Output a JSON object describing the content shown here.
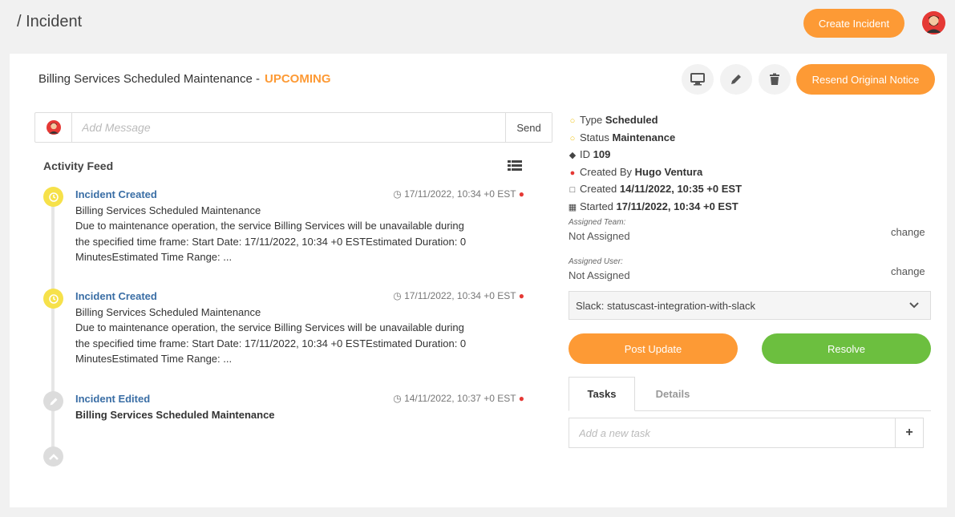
{
  "header": {
    "title": "/ Incident",
    "create_label": "Create Incident"
  },
  "incident": {
    "name": "Billing Services Scheduled Maintenance -",
    "status": "UPCOMING",
    "resend_label": "Resend Original Notice"
  },
  "message": {
    "placeholder": "Add Message",
    "send_label": "Send"
  },
  "feed": {
    "title": "Activity Feed",
    "entries": [
      {
        "title": "Incident Created",
        "time": "17/11/2022, 10:34 +0 EST",
        "subtitle": "Billing Services Scheduled Maintenance",
        "line1": "Due to maintenance operation, the service Billing Services will be unavailable during",
        "line2": "the specified time frame: Start Date: 17/11/2022, 10:34 +0 ESTEstimated Duration: 0",
        "line3": "MinutesEstimated Time Range: ..."
      },
      {
        "title": "Incident Created",
        "time": "17/11/2022, 10:34 +0 EST",
        "subtitle": "Billing Services Scheduled Maintenance",
        "line1": "Due to maintenance operation, the service Billing Services will be unavailable during",
        "line2": "the specified time frame: Start Date: 17/11/2022, 10:34 +0 ESTEstimated Duration: 0",
        "line3": "MinutesEstimated Time Range: ..."
      },
      {
        "title": "Incident Edited",
        "time": "14/11/2022, 10:37 +0 EST",
        "subtitle": "Billing Services Scheduled Maintenance"
      }
    ]
  },
  "meta": {
    "type_label": "Type",
    "type_value": "Scheduled",
    "status_label": "Status",
    "status_value": "Maintenance",
    "id_label": "ID",
    "id_value": "109",
    "created_by_label": "Created By",
    "created_by_value": "Hugo Ventura",
    "created_label": "Created",
    "created_value": "14/11/2022, 10:35 +0 EST",
    "started_label": "Started",
    "started_value": "17/11/2022, 10:34 +0 EST"
  },
  "assignment": {
    "team_label": "Assigned Team:",
    "team_value": "Not Assigned",
    "user_label": "Assigned User:",
    "user_value": "Not Assigned",
    "change_label": "change"
  },
  "slack": {
    "selected": "Slack: statuscast-integration-with-slack"
  },
  "actions": {
    "post_update": "Post Update",
    "resolve": "Resolve"
  },
  "tabs": {
    "tasks": "Tasks",
    "details": "Details"
  },
  "tasks": {
    "placeholder": "Add a new task",
    "add_label": "+"
  },
  "colors": {
    "accent": "#fd9a35",
    "resolve": "#6cbf3f",
    "link": "#3a6ea5"
  }
}
